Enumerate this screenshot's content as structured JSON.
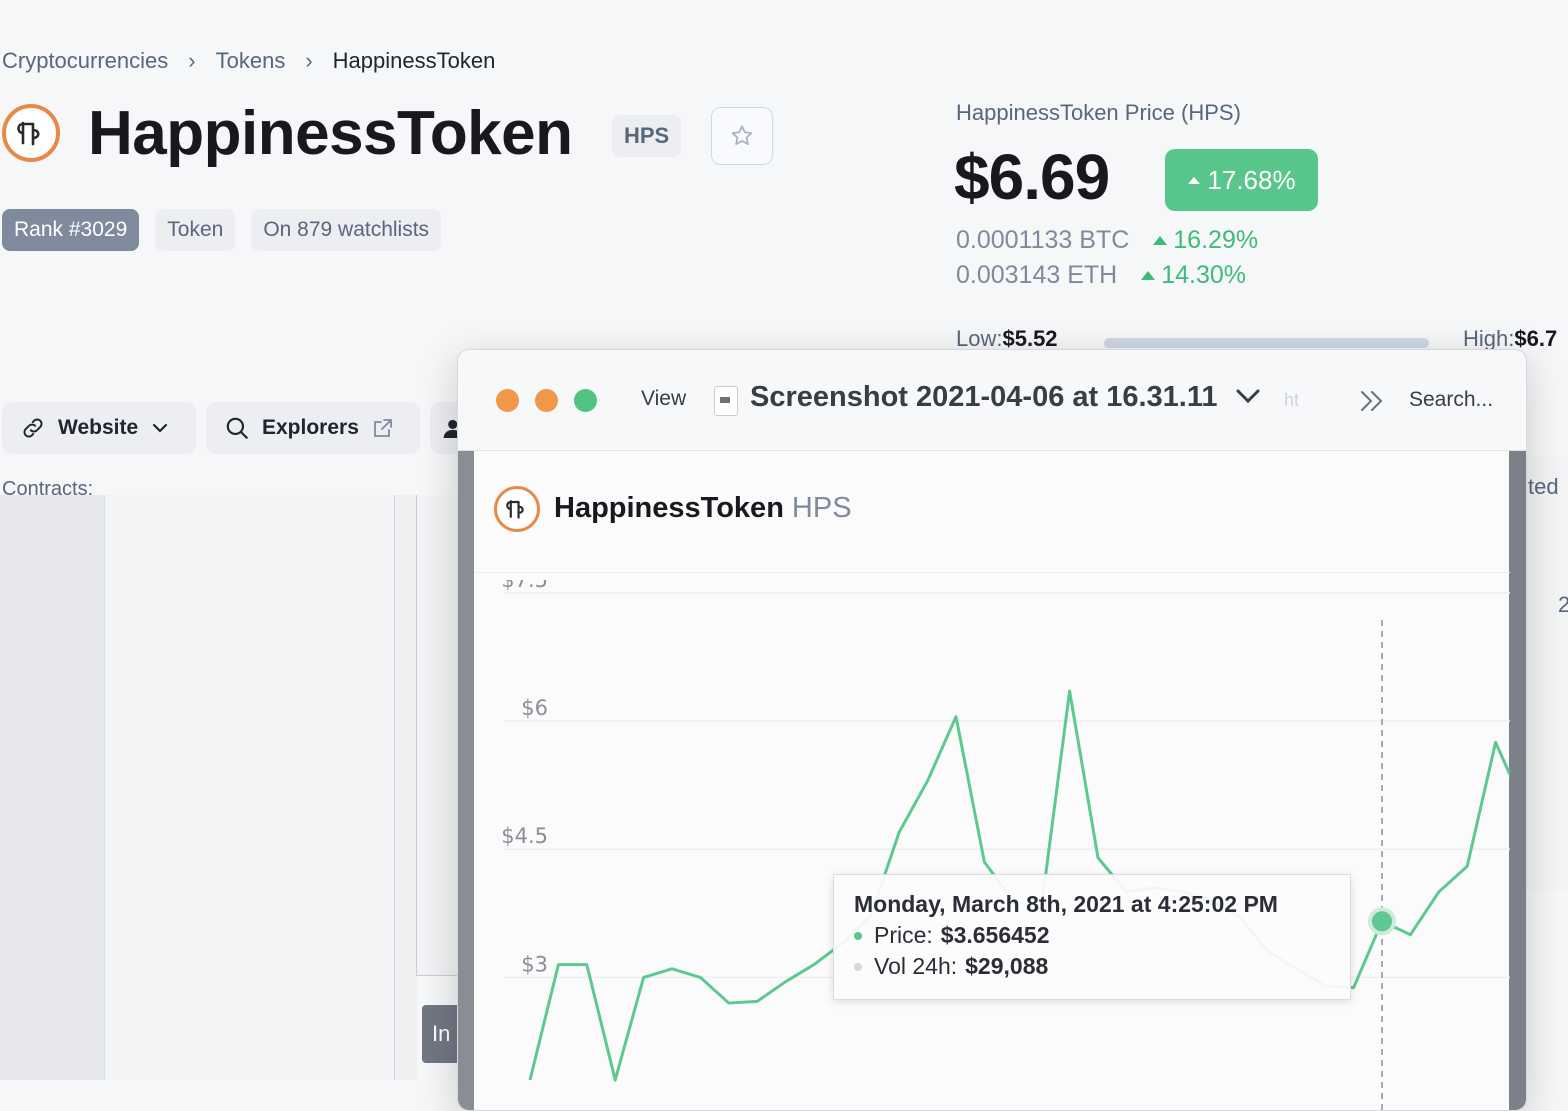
{
  "breadcrumb": {
    "items": [
      "Cryptocurrencies",
      "Tokens"
    ],
    "current": "HappinessToken",
    "separator": "›"
  },
  "coin": {
    "name": "HappinessToken",
    "symbol": "HPS",
    "tags": {
      "rank": "Rank #3029",
      "type": "Token",
      "watchlists": "On 879 watchlists"
    }
  },
  "price": {
    "label": "HappinessToken Price (HPS)",
    "value": "$6.69",
    "change_24h": "17.68%",
    "btc": "0.0001133 BTC",
    "btc_change": "16.29%",
    "eth": "0.003143 ETH",
    "eth_change": "14.30%",
    "low_label": "Low:",
    "low_value": "$5.52",
    "high_label": "High:",
    "high_value": "$6.7"
  },
  "links": {
    "website": "Website",
    "explorers": "Explorers",
    "contracts": "Contracts:"
  },
  "window": {
    "view_label": "View",
    "title": "Screenshot 2021-04-06 at 16.31.11",
    "faded_text": "ht",
    "search_placeholder": "Search...",
    "header_name": "HappinessToken",
    "header_symbol": "HPS"
  },
  "background": {
    "inbox_text": "In",
    "edge_text_1": "ted",
    "edge_text_2": "2"
  },
  "tooltip": {
    "date": "Monday, March 8th, 2021 at 4:25:02 PM",
    "price_label": "Price:",
    "price_value": "$3.656452",
    "vol_label": "Vol 24h:",
    "vol_value": "$29,088"
  },
  "colors": {
    "accent_green": "#58c68a",
    "line_green": "#5dc88f",
    "logo_orange": "#e8894a",
    "traffic_red": "#f0974a",
    "traffic_yellow": "#f0974a",
    "traffic_green": "#4fc37f"
  },
  "icons": {
    "breadcrumb_sep": "chevron-right-icon",
    "star": "star-icon",
    "website": "link-icon",
    "explorers": "search-icon",
    "external": "external-link-icon",
    "dropdown": "chevron-down-icon"
  },
  "chart_data": {
    "type": "line",
    "y_ticks": [
      "$7.5",
      "$6",
      "$4.5",
      "$3"
    ],
    "ylim": [
      1.8,
      8.0
    ],
    "grid": true,
    "series": [
      {
        "values": [
          1.8,
          3.15,
          3.15,
          1.8,
          3.0,
          3.1,
          3.0,
          2.7,
          2.72,
          2.95,
          3.15,
          3.4,
          3.72,
          4.7,
          5.3,
          6.05,
          4.35,
          3.9,
          3.8,
          6.35,
          4.4,
          4.0,
          4.05,
          4.0,
          3.9,
          3.7,
          3.3,
          3.1,
          2.9,
          2.88,
          3.656452,
          3.5,
          4.0,
          4.3,
          5.75,
          5.0
        ]
      }
    ],
    "highlight_index": 30
  }
}
